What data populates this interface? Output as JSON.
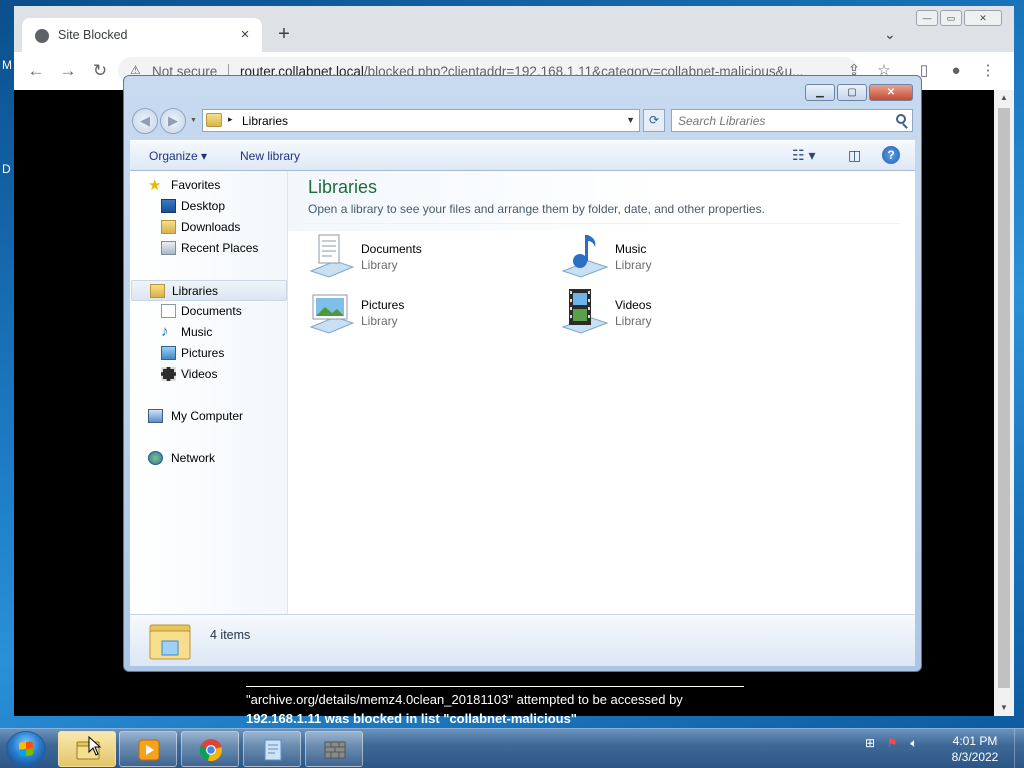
{
  "desktop": {
    "left_letter_1": "M",
    "left_letter_2": "D"
  },
  "browser": {
    "tab_title": "Site Blocked",
    "tab_close": "×",
    "new_tab": "+",
    "tab_search": "⌄",
    "window_buttons": {
      "minimize": "—",
      "maximize": "▭",
      "close": "✕"
    },
    "back": "←",
    "forward": "→",
    "reload": "↻",
    "omnibox": {
      "security_label": "Not secure",
      "url_host": "router.collabnet.local",
      "url_path": "/blocked.php?clientaddr=192.168.1.11&category=collabnet-malicious&u..."
    },
    "share_icon": "⇪",
    "star_icon": "☆",
    "sidepanel_icon": "▯",
    "profile_icon": "●",
    "menu_icon": "⋮",
    "blocked_message_line1": "\"archive.org/details/memz4.0clean_20181103\" attempted to be accessed by",
    "blocked_message_line2": "192.168.1.11 was blocked in list \"collabnet-malicious\"",
    "scroll_up": "▲",
    "scroll_down": "▼"
  },
  "explorer": {
    "caption": {
      "minimize": "▁",
      "maximize": "▢",
      "close": "✕"
    },
    "address": {
      "path": "Libraries",
      "dropdown": "▼",
      "arrow": "▸"
    },
    "refresh": "⟳",
    "search": {
      "placeholder": "Search Libraries"
    },
    "commandbar": {
      "organize": "Organize ▾",
      "new_library": "New library",
      "views_icon": "☷ ▾",
      "preview_icon": "◫",
      "help_icon": "?"
    },
    "nav": {
      "favorites": "Favorites",
      "desktop": "Desktop",
      "downloads": "Downloads",
      "recent_places": "Recent Places",
      "libraries": "Libraries",
      "documents": "Documents",
      "music": "Music",
      "pictures": "Pictures",
      "videos": "Videos",
      "my_computer": "My Computer",
      "network": "Network"
    },
    "content": {
      "title": "Libraries",
      "subtitle": "Open a library to see your files and arrange them by folder, date, and other properties.",
      "libraries": [
        {
          "name": "Documents",
          "type": "Library"
        },
        {
          "name": "Music",
          "type": "Library"
        },
        {
          "name": "Pictures",
          "type": "Library"
        },
        {
          "name": "Videos",
          "type": "Library"
        }
      ]
    },
    "details": {
      "count": "4 items"
    }
  },
  "taskbar": {
    "clock_time": "4:01 PM",
    "clock_date": "8/3/2022"
  },
  "colors": {
    "explorer_title_green": "#1e6b3a",
    "command_text": "#1e3287",
    "taskbar_blue": "#3f6a98"
  }
}
